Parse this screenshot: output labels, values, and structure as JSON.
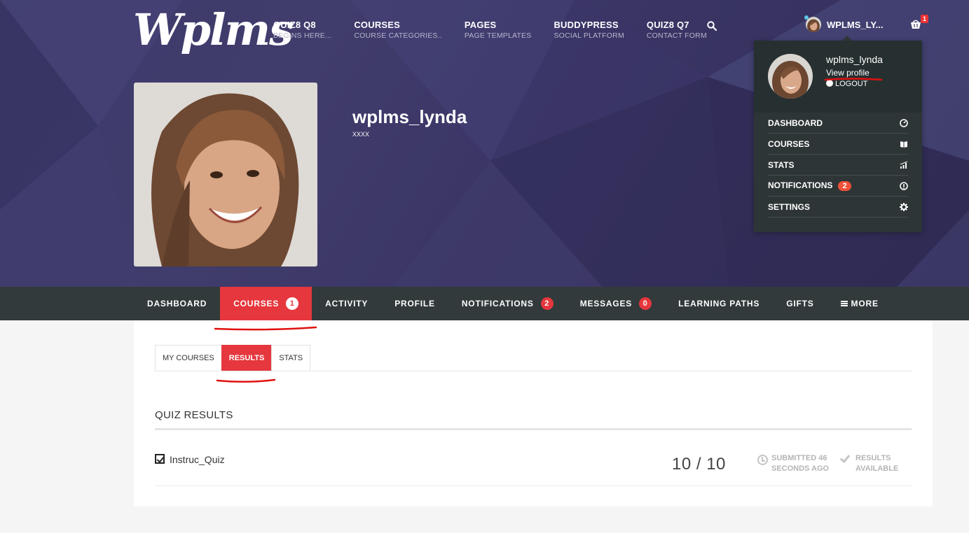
{
  "brand": {
    "logo_text": "Wplms"
  },
  "top_nav": [
    {
      "title": "QUIZ8 Q8",
      "subtitle": "BEGINS HERE..."
    },
    {
      "title": "COURSES",
      "subtitle": "COURSE CATEGORIES.."
    },
    {
      "title": "PAGES",
      "subtitle": "PAGE TEMPLATES"
    },
    {
      "title": "BUDDYPRESS",
      "subtitle": "SOCIAL PLATFORM"
    },
    {
      "title": "QUIZ8 Q7",
      "subtitle": "CONTACT FORM"
    }
  ],
  "user_nav": {
    "username": "WPLMS_LY...",
    "cart_count": "1"
  },
  "profile": {
    "name": "wplms_lynda",
    "subtitle": "xxxx"
  },
  "dropdown": {
    "username": "wplms_lynda",
    "view_profile": "View profile",
    "logout": "LOGOUT",
    "items": [
      {
        "label": "DASHBOARD",
        "icon": "dashboard-icon"
      },
      {
        "label": "COURSES",
        "icon": "book-icon"
      },
      {
        "label": "STATS",
        "icon": "stats-icon"
      },
      {
        "label": "NOTIFICATIONS",
        "icon": "info-icon",
        "badge": "2"
      },
      {
        "label": "SETTINGS",
        "icon": "gear-icon"
      }
    ]
  },
  "tabs": [
    {
      "label": "DASHBOARD"
    },
    {
      "label": "COURSES",
      "count": "1",
      "active": true
    },
    {
      "label": "ACTIVITY"
    },
    {
      "label": "PROFILE"
    },
    {
      "label": "NOTIFICATIONS",
      "count": "2"
    },
    {
      "label": "MESSAGES",
      "count": "0"
    },
    {
      "label": "LEARNING PATHS"
    },
    {
      "label": "GIFTS"
    },
    {
      "label": "MORE"
    }
  ],
  "subtabs": [
    {
      "label": "MY COURSES"
    },
    {
      "label": "RESULTS",
      "active": true
    },
    {
      "label": "STATS"
    }
  ],
  "section": {
    "title": "QUIZ RESULTS"
  },
  "quiz": {
    "name": "Instruc_Quiz",
    "score": "10 / 10",
    "submitted_line1": "SUBMITTED 46",
    "submitted_line2": "SECONDS AGO",
    "results_line1": "RESULTS",
    "results_line2": "AVAILABLE"
  },
  "colors": {
    "accent": "#e5373d",
    "nav_bg": "#323a3b",
    "dropdown_bg": "#2e3536",
    "hero_bg": "#3d3b6b"
  }
}
